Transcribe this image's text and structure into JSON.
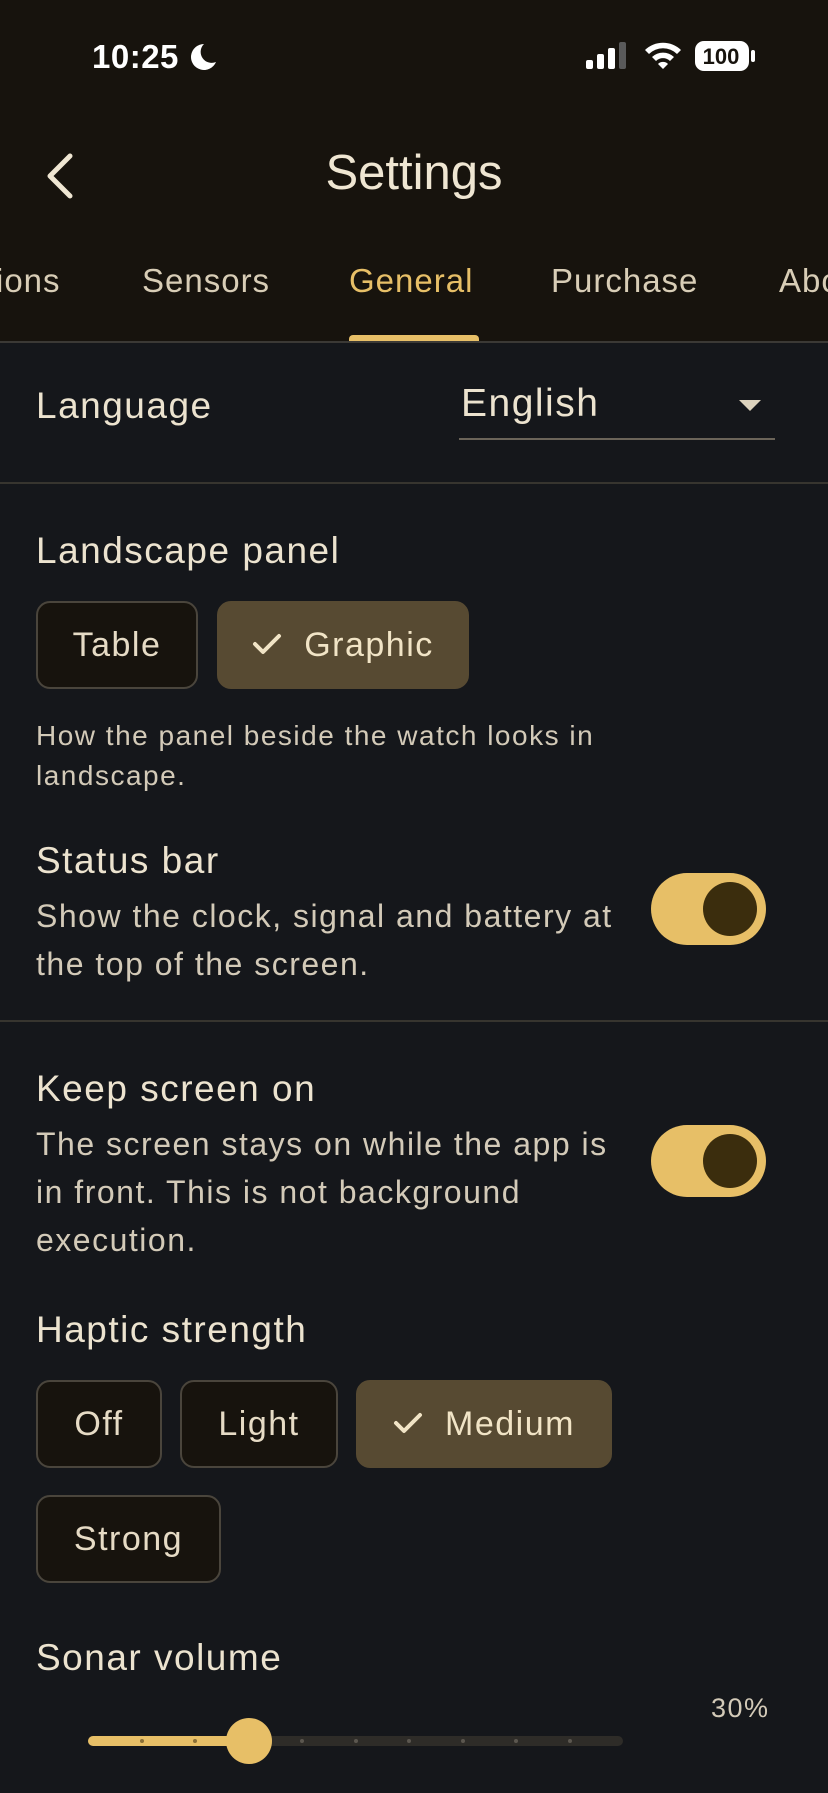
{
  "status_bar": {
    "time": "10:25",
    "battery": "100",
    "icons": [
      "moon-icon",
      "signal-icon",
      "wifi-icon",
      "battery-icon"
    ]
  },
  "header": {
    "title": "Settings",
    "back_icon": "chevron-left-icon"
  },
  "tabs": [
    {
      "label": "ions",
      "active": false
    },
    {
      "label": "Sensors",
      "active": false
    },
    {
      "label": "General",
      "active": true
    },
    {
      "label": "Purchase",
      "active": false
    },
    {
      "label": "Abo",
      "active": false
    }
  ],
  "language": {
    "label": "Language",
    "value": "English"
  },
  "landscape_panel": {
    "title": "Landscape panel",
    "options": [
      {
        "label": "Table",
        "selected": false
      },
      {
        "label": "Graphic",
        "selected": true
      }
    ],
    "helper": "How the panel beside the watch looks in landscape."
  },
  "status_bar_setting": {
    "title": "Status bar",
    "description": "Show the clock, signal and battery at the top of the screen.",
    "enabled": true
  },
  "keep_screen_on": {
    "title": "Keep screen on",
    "description": "The screen stays on while the app is in front. This is not background execution.",
    "enabled": true
  },
  "haptic_strength": {
    "title": "Haptic strength",
    "options": [
      {
        "label": "Off",
        "selected": false
      },
      {
        "label": "Light",
        "selected": false
      },
      {
        "label": "Medium",
        "selected": true
      },
      {
        "label": "Strong",
        "selected": false
      }
    ]
  },
  "sonar_volume": {
    "title": "Sonar volume",
    "value_text": "30%",
    "value": 0.3,
    "steps": 10
  },
  "colors": {
    "accent": "#e7bf67",
    "background": "#15171b",
    "header_background": "#17130d",
    "chip_selected": "#574a32"
  }
}
